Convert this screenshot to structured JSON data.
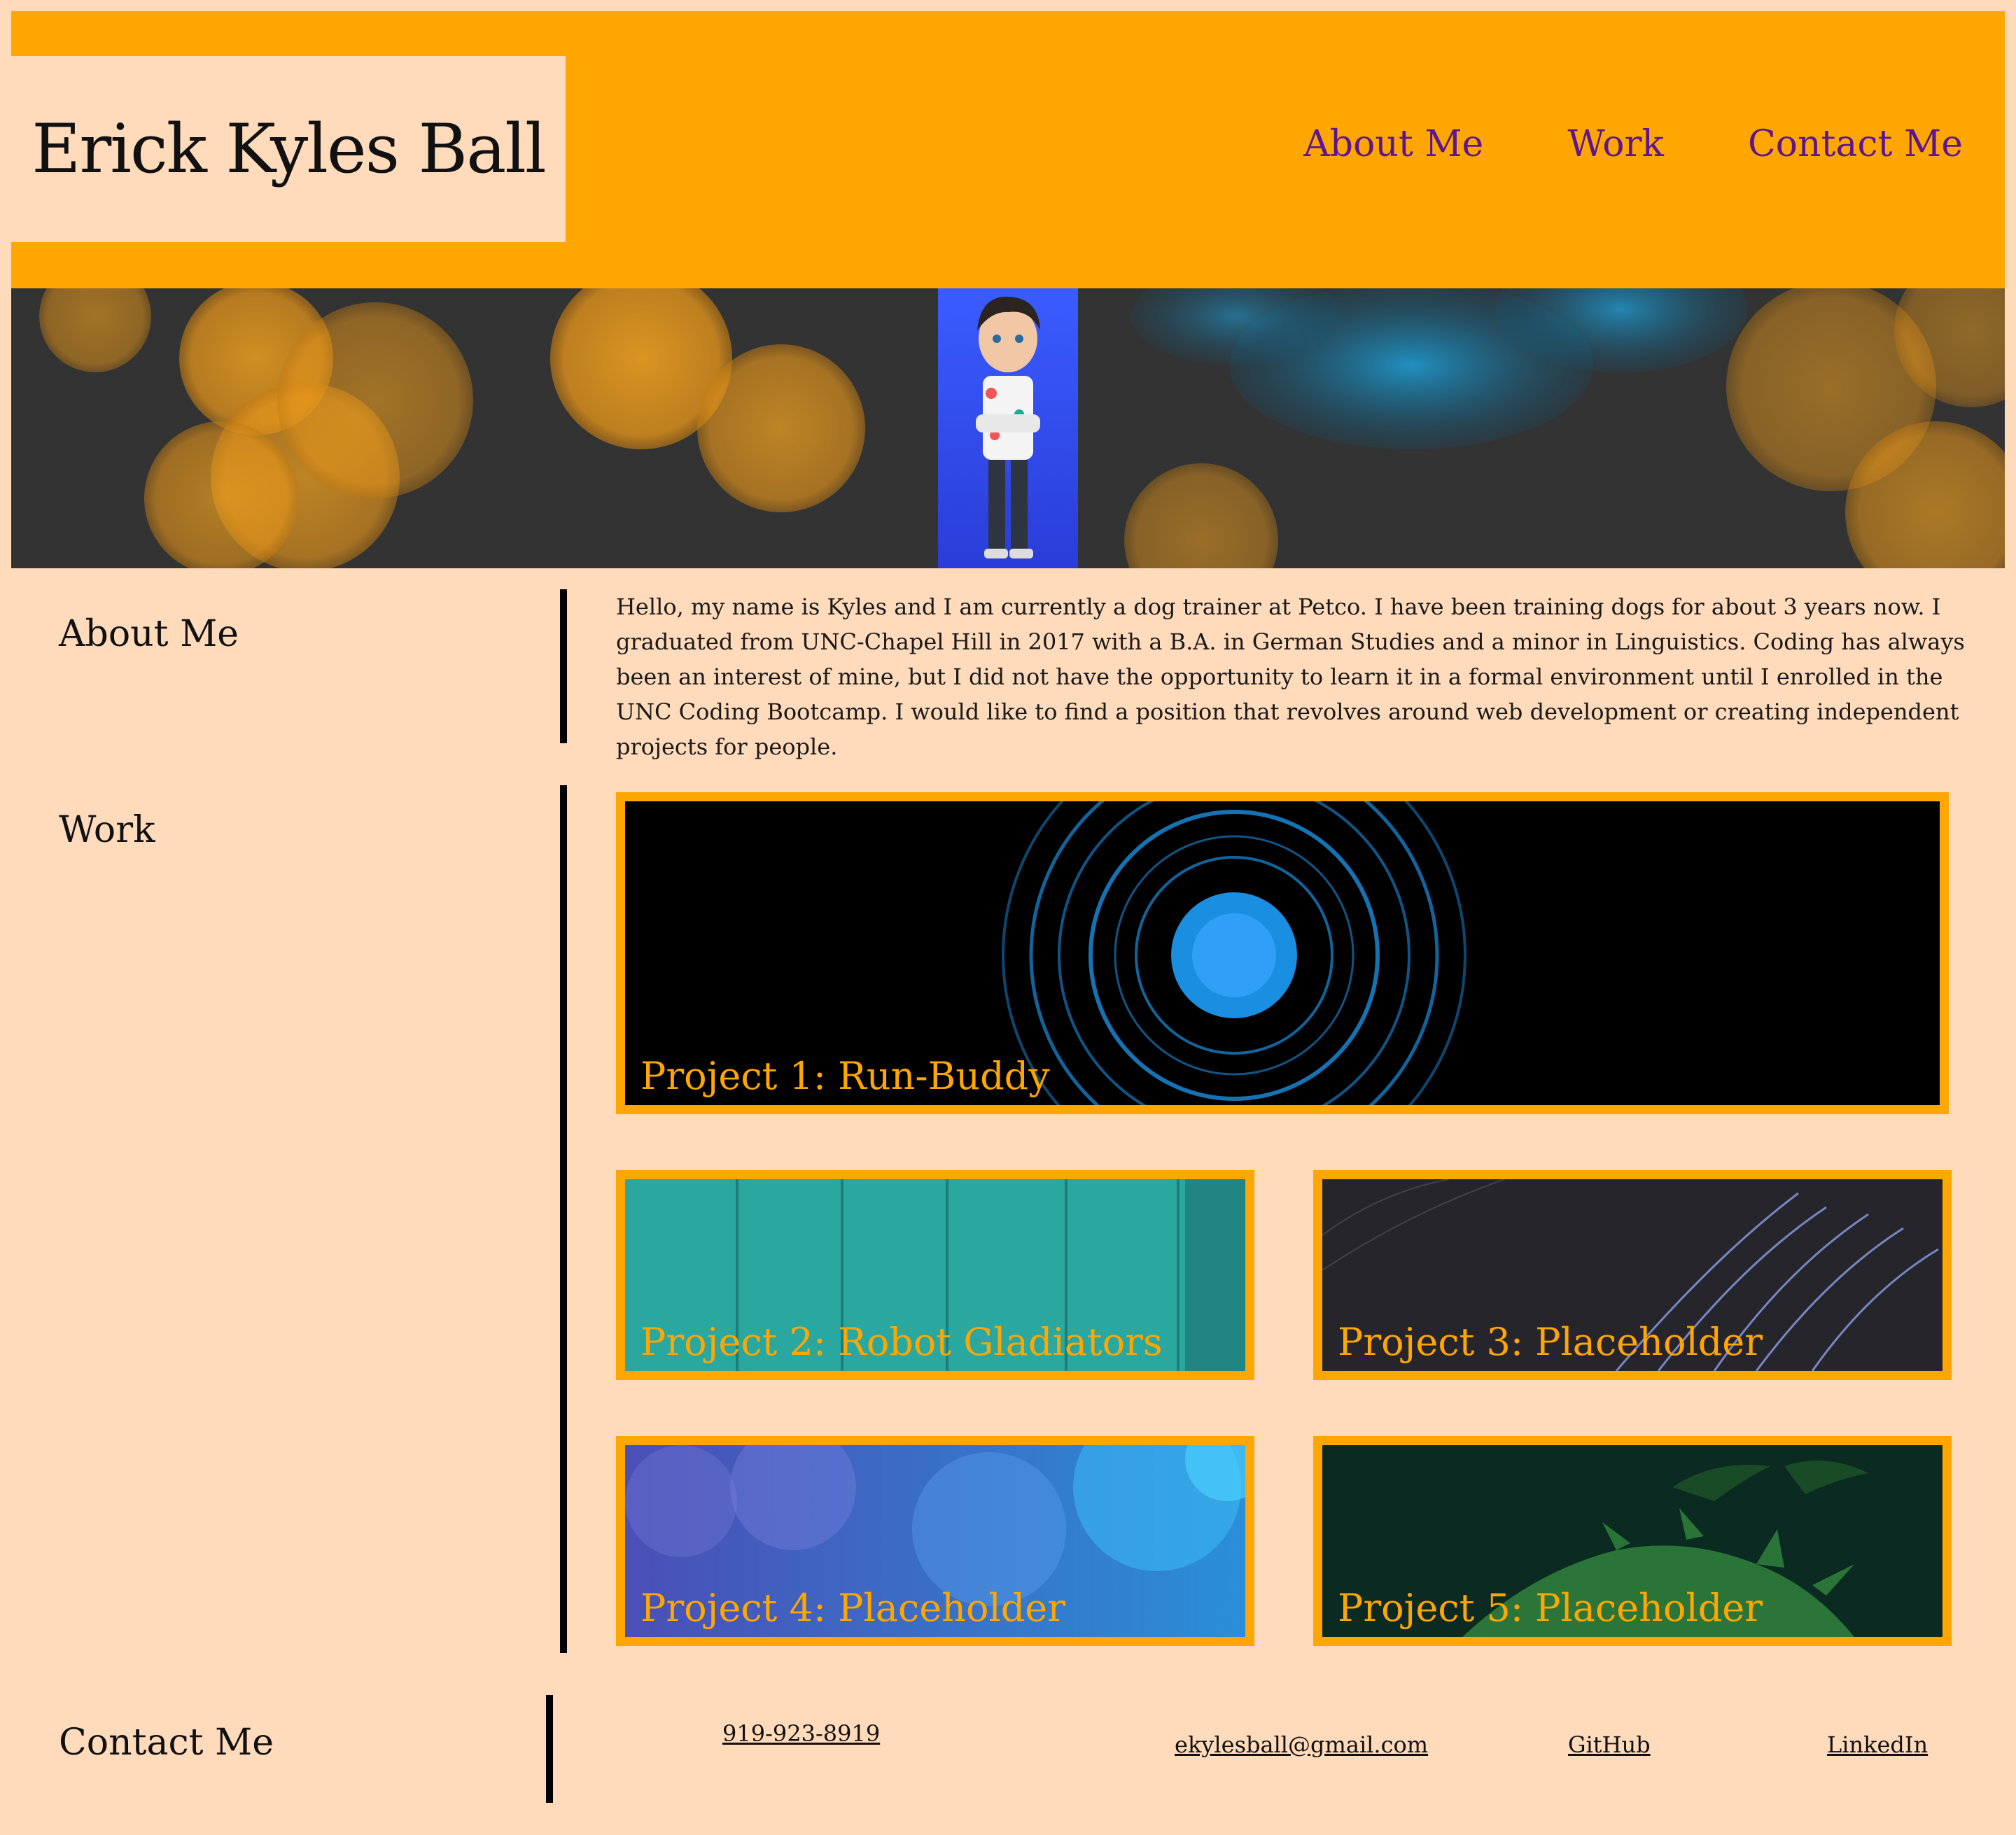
{
  "header": {
    "title": "Erick Kyles Ball",
    "nav": [
      {
        "label": "About Me"
      },
      {
        "label": "Work"
      },
      {
        "label": "Contact Me"
      }
    ]
  },
  "about": {
    "heading": "About Me",
    "text": "Hello, my name is Kyles and I am currently a dog trainer at Petco. I have been training dogs for about 3 years now. I graduated from UNC-Chapel Hill in 2017 with a B.A. in German Studies and a minor in Linguistics. Coding has always been an interest of mine, but I did not have the opportunity to learn it in a formal environment until I enrolled in the UNC Coding Bootcamp. I would like to find a position that revolves around web development or creating independent projects for people."
  },
  "work": {
    "heading": "Work",
    "projects": [
      {
        "title": "Project 1: Run-Buddy"
      },
      {
        "title": "Project 2: Robot Gladiators"
      },
      {
        "title": "Project 3: Placeholder"
      },
      {
        "title": "Project 4: Placeholder"
      },
      {
        "title": "Project 5: Placeholder"
      }
    ]
  },
  "contact": {
    "heading": "Contact Me",
    "phone": "919-923-8919",
    "email": "ekylesball@gmail.com",
    "github": "GitHub",
    "linkedin": "LinkedIn"
  },
  "colors": {
    "background": "#ffdabb",
    "accent": "#ffa600",
    "nav_link": "#5c168f"
  }
}
